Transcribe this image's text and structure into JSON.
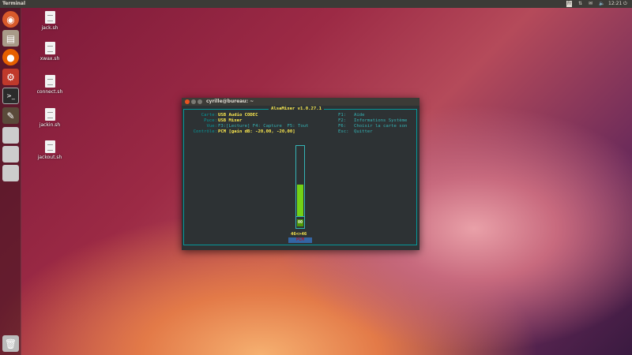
{
  "topbar": {
    "title": "Terminal",
    "indicators": [
      "Fr",
      "⇅",
      "✉",
      "🔈"
    ],
    "clock": "12:21",
    "power": "⏻"
  },
  "launcher": {
    "items": [
      "ubuntu-dash",
      "files",
      "firefox",
      "settings",
      "terminal",
      "text-editor",
      "drive-1",
      "drive-2",
      "drive-3"
    ],
    "trash": "trash"
  },
  "desktop": {
    "icons": [
      "jack.sh",
      "xwax.sh",
      "connect.sh",
      "jackin.sh",
      "jackout.sh"
    ]
  },
  "window": {
    "title": "cyrille@bureau: ~",
    "alsamixer": {
      "header": "AlsaMixer v1.0.27.1",
      "info": [
        {
          "label": "Carte:",
          "value": "USB Audio CODEC"
        },
        {
          "label": "Puce:",
          "value": "USB Mixer"
        },
        {
          "label": "Vue:",
          "value": "F3:[Lecture] F4: Capture  F5: Tout"
        },
        {
          "label": "Contrôle:",
          "value": "PCM [gain dB: -20,00, -20,00]"
        }
      ],
      "help": [
        {
          "key": "F1:",
          "text": "Aide"
        },
        {
          "key": "F2:",
          "text": "Informations Système"
        },
        {
          "key": "F6:",
          "text": "Choisir la carte son"
        },
        {
          "key": "Esc:",
          "text": "Quitter"
        }
      ],
      "channel": {
        "name": "PCM",
        "level_percent": 46,
        "level_label": "46<>46",
        "mute_label": "00",
        "fill_color": "#73d216"
      }
    }
  }
}
